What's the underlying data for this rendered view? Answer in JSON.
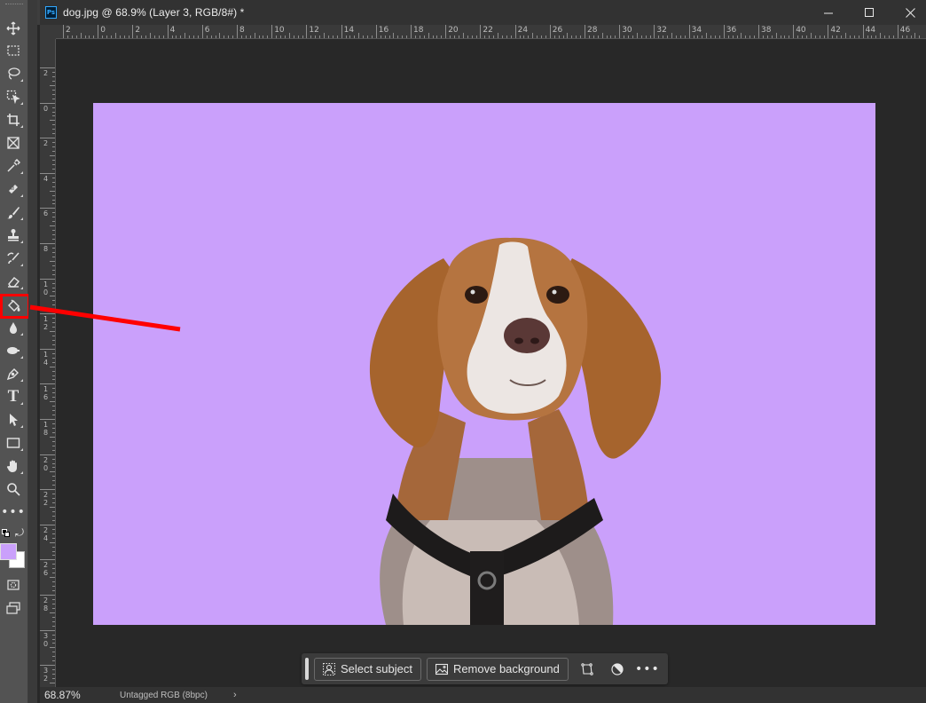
{
  "document": {
    "title": "dog.jpg @ 68.9% (Layer 3, RGB/8#) *",
    "app_icon_text": "Ps",
    "canvas_color": "#caa0fb"
  },
  "window_controls": {
    "minimize": "minimize-icon",
    "maximize": "maximize-icon",
    "close": "close-icon"
  },
  "rulers": {
    "top_labels": [
      "2",
      "0",
      "2",
      "4",
      "6",
      "8",
      "10",
      "12",
      "14",
      "16",
      "18",
      "20",
      "22",
      "24",
      "26",
      "28",
      "30",
      "32",
      "34",
      "36",
      "38",
      "40",
      "42",
      "44",
      "46"
    ],
    "left_labels": [
      "2",
      "0",
      "2",
      "4",
      "6",
      "8",
      "1\n0",
      "1\n2",
      "1\n4",
      "1\n6",
      "1\n8",
      "2\n0",
      "2\n2",
      "2\n4",
      "2\n6",
      "2\n8",
      "3\n0",
      "3\n2"
    ]
  },
  "tools": [
    {
      "name": "move-tool-icon"
    },
    {
      "name": "marquee-tool-icon"
    },
    {
      "name": "lasso-tool-icon"
    },
    {
      "name": "object-selection-tool-icon"
    },
    {
      "name": "crop-tool-icon"
    },
    {
      "name": "frame-tool-icon"
    },
    {
      "name": "eyedropper-tool-icon"
    },
    {
      "name": "healing-brush-tool-icon"
    },
    {
      "name": "brush-tool-icon"
    },
    {
      "name": "clone-stamp-tool-icon"
    },
    {
      "name": "history-brush-tool-icon"
    },
    {
      "name": "eraser-tool-icon"
    },
    {
      "name": "paint-bucket-tool-icon",
      "highlighted": true
    },
    {
      "name": "blur-tool-icon"
    },
    {
      "name": "dodge-tool-icon"
    },
    {
      "name": "pen-tool-icon"
    },
    {
      "name": "type-tool-icon"
    },
    {
      "name": "path-selection-tool-icon"
    },
    {
      "name": "rectangle-tool-icon"
    },
    {
      "name": "hand-tool-icon"
    },
    {
      "name": "zoom-tool-icon"
    },
    {
      "name": "more-tools-icon"
    }
  ],
  "colors": {
    "foreground": "#caa0fb",
    "background": "#ffffff",
    "highlight": "#ff0000"
  },
  "contextual_taskbar": {
    "select_subject_label": "Select subject",
    "remove_background_label": "Remove background"
  },
  "status": {
    "zoom": "68.87%",
    "color_profile": "Untagged RGB (8bpc)",
    "arrow": "›"
  }
}
